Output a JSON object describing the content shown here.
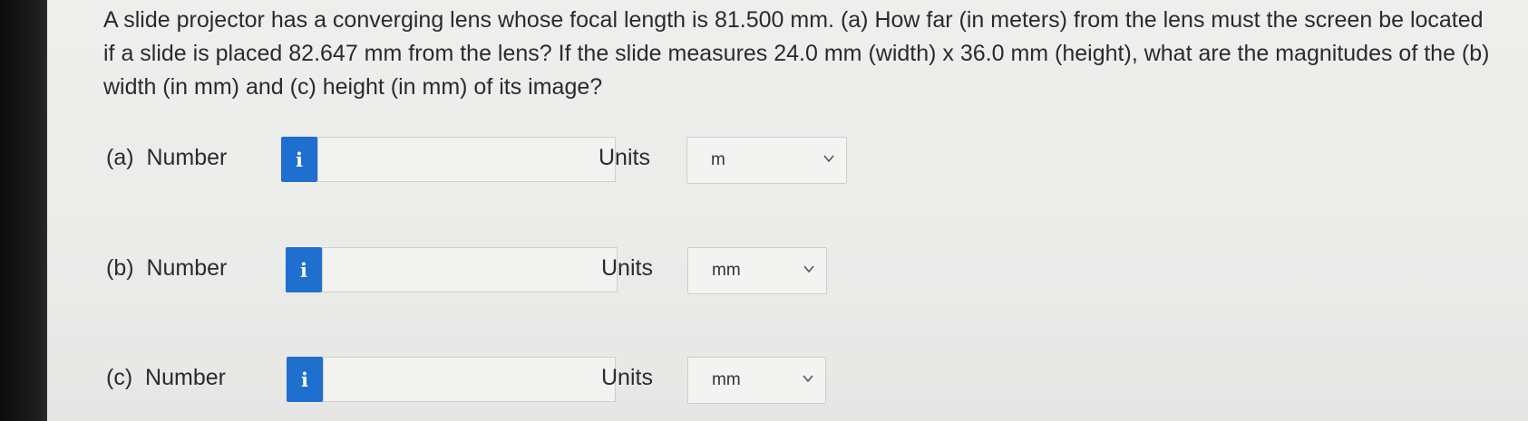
{
  "question": {
    "text": "A slide projector has a converging lens whose focal length is 81.500 mm. (a) How far (in meters) from the lens must the screen be located if a slide is placed 82.647 mm from the lens? If the slide measures 24.0 mm (width) x 36.0 mm (height), what are the magnitudes of the (b) width (in mm) and (c) height (in mm) of its image?"
  },
  "parts": [
    {
      "label": "(a)  Number",
      "info_icon": "info-icon",
      "info_glyph": "i",
      "number_value": "",
      "units_label": "Units",
      "units_value": "m"
    },
    {
      "label": "(b)  Number",
      "info_icon": "info-icon",
      "info_glyph": "i",
      "number_value": "",
      "units_label": "Units",
      "units_value": "mm"
    },
    {
      "label": "(c)  Number",
      "info_icon": "info-icon",
      "info_glyph": "i",
      "number_value": "",
      "units_label": "Units",
      "units_value": "mm"
    }
  ],
  "colors": {
    "info_button": "#1f6fcf",
    "background": "#ececeb",
    "text": "#2b2b2b"
  }
}
